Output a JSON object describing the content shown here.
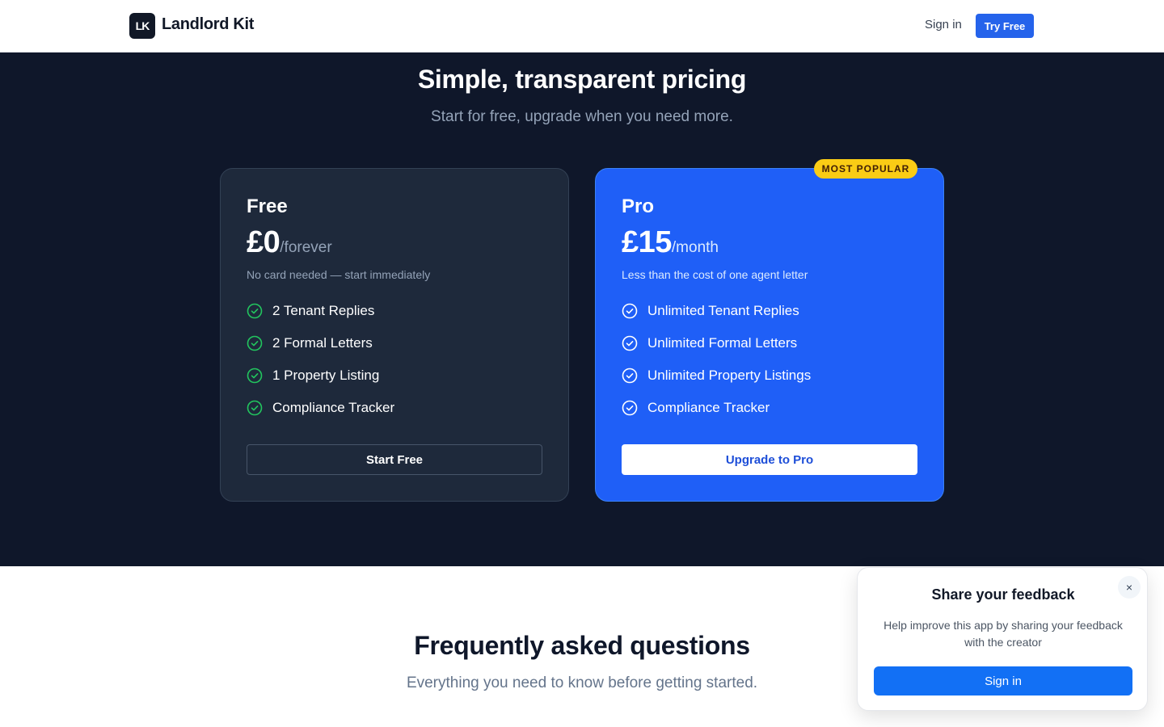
{
  "header": {
    "logo_mark": "LK",
    "app_name": "Landlord Kit",
    "sign_in": "Sign in",
    "try_free": "Try Free"
  },
  "pricing": {
    "title": "Simple, transparent pricing",
    "subtitle": "Start for free, upgrade when you need more.",
    "badge": "MOST POPULAR",
    "plans": [
      {
        "name": "Free",
        "price": "£0",
        "period": "/forever",
        "note": "No card needed — start immediately",
        "features": [
          "2 Tenant Replies",
          "2 Formal Letters",
          "1 Property Listing",
          "Compliance Tracker"
        ],
        "cta": "Start Free"
      },
      {
        "name": "Pro",
        "price": "£15",
        "period": "/month",
        "note": "Less than the cost of one agent letter",
        "features": [
          "Unlimited Tenant Replies",
          "Unlimited Formal Letters",
          "Unlimited Property Listings",
          "Compliance Tracker"
        ],
        "cta": "Upgrade to Pro"
      }
    ]
  },
  "faq": {
    "title": "Frequently asked questions",
    "subtitle": "Everything you need to know before getting started."
  },
  "feedback_popup": {
    "close_icon": "×",
    "title": "Share your feedback",
    "text": "Help improve this app by sharing your feedback with the creator",
    "button": "Sign in"
  },
  "colors": {
    "brand_blue": "#2563eb",
    "dark_bg": "#0f172a",
    "pro_card": "#1f5ff7",
    "badge": "#facc15",
    "check_green": "#22c55e"
  },
  "icons": {
    "feature_check": "check-circle-icon",
    "popup_close": "close-icon"
  }
}
